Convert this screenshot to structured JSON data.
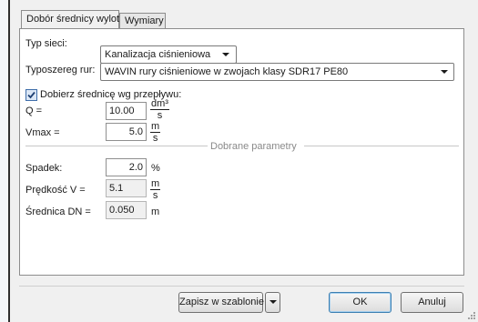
{
  "tabs": [
    {
      "label": "Dobór średnicy wylotowej",
      "active": true
    },
    {
      "label": "Wymiary",
      "active": false
    }
  ],
  "form": {
    "network_type_label": "Typ sieci:",
    "network_type_value": "Kanalizacja ciśnieniowa",
    "pipe_series_label": "Typoszereg rur:",
    "pipe_series_value": "WAVIN rury ciśnieniowe w zwojach klasy SDR17 PE80",
    "flow_checkbox_label": "Dobierz średnicę wg przepływu:",
    "flow_checkbox_checked": true,
    "q_label": "Q =",
    "q_value": "10.00",
    "q_unit_num": "dm³",
    "q_unit_den": "s",
    "vmax_label": "Vmax =",
    "vmax_value": "5.0",
    "vmax_unit_num": "m",
    "vmax_unit_den": "s",
    "section_title": "Dobrane parametry",
    "slope_label": "Spadek:",
    "slope_value": "2.0",
    "slope_unit": "%",
    "velocity_label": "Prędkość V =",
    "velocity_value": "5.1",
    "velocity_unit_num": "m",
    "velocity_unit_den": "s",
    "diameter_label": "Średnica DN =",
    "diameter_value": "0.050",
    "diameter_unit": "m"
  },
  "buttons": {
    "save_template": "Zapisz w szablonie",
    "ok": "OK",
    "cancel": "Anuluj"
  },
  "colors": {
    "dialog_bg": "#f0f0f0",
    "panel_bg": "#ffffff",
    "checkbox_check": "#1e3f73"
  }
}
